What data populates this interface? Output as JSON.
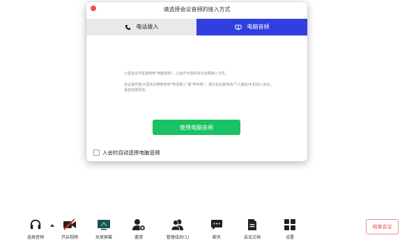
{
  "dialog": {
    "title": "请选择会议音频的接入方式",
    "tabs": [
      {
        "label": "电话拨入",
        "icon": "phone-icon"
      },
      {
        "label": "电脑音频",
        "icon": "computer-icon"
      }
    ],
    "info_line1": "小型会议可直接使用\"电脑音频\"，以此作为您的会议音频接入方式；",
    "info_line2": "会议室终端/大型会议推荐使用\"电话拨入\"或\"呼叫我\"，通过会议室电话/个人座机/手机加入会议，语音效果更佳。",
    "primary_button": "使用电脑音频",
    "checkbox_label": "入会时自动选择电脑音频"
  },
  "toolbar": {
    "items": [
      {
        "label": "选择音频",
        "icon": "headset-icon"
      },
      {
        "label": "开启视频",
        "icon": "video-off-icon"
      },
      {
        "label": "共享屏幕",
        "icon": "share-screen-icon"
      },
      {
        "label": "邀请",
        "icon": "invite-icon"
      },
      {
        "label": "管理成员(1)",
        "icon": "members-icon"
      },
      {
        "label": "聊天",
        "icon": "chat-icon"
      },
      {
        "label": "会议文档",
        "icon": "document-icon"
      },
      {
        "label": "设置",
        "icon": "settings-icon"
      }
    ],
    "end_button": "结束会议"
  },
  "colors": {
    "accent_tab": "#2f3fe0",
    "primary_green": "#19c262",
    "end_red": "#e24a4a"
  }
}
